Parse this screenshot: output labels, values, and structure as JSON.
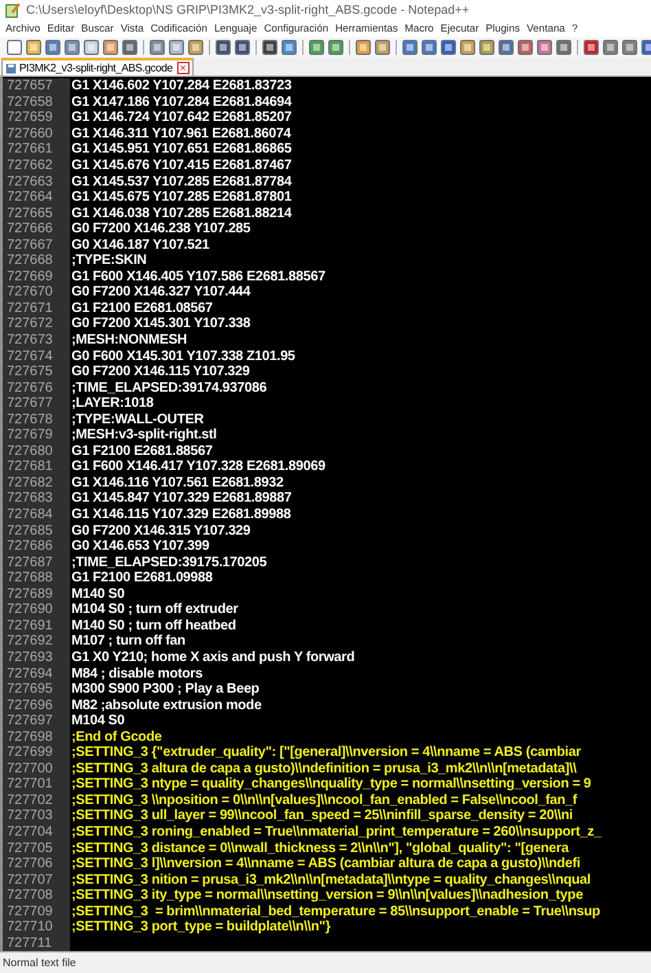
{
  "window": {
    "title": "C:\\Users\\eloyf\\Desktop\\NS GRIP\\PI3MK2_v3-split-right_ABS.gcode - Notepad++"
  },
  "menu": [
    "Archivo",
    "Editar",
    "Buscar",
    "Vista",
    "Codificación",
    "Lenguaje",
    "Configuración",
    "Herramientas",
    "Macro",
    "Ejecutar",
    "Plugins",
    "Ventana",
    "?"
  ],
  "tabs": [
    {
      "label": "PI3MK2_v3-split-right_ABS.gcode",
      "selected": true,
      "close": "×"
    }
  ],
  "editor": {
    "lines": [
      {
        "number": "727657",
        "text": "G1 X146.602 Y107.284 E2681.83723",
        "color": "#ffffff"
      },
      {
        "number": "727658",
        "text": "G1 X147.186 Y107.284 E2681.84694",
        "color": "#ffffff"
      },
      {
        "number": "727659",
        "text": "G1 X146.724 Y107.642 E2681.85207",
        "color": "#ffffff"
      },
      {
        "number": "727660",
        "text": "G1 X146.311 Y107.961 E2681.86074",
        "color": "#ffffff"
      },
      {
        "number": "727661",
        "text": "G1 X145.951 Y107.651 E2681.86865",
        "color": "#ffffff"
      },
      {
        "number": "727662",
        "text": "G1 X145.676 Y107.415 E2681.87467",
        "color": "#ffffff"
      },
      {
        "number": "727663",
        "text": "G1 X145.537 Y107.285 E2681.87784",
        "color": "#ffffff"
      },
      {
        "number": "727664",
        "text": "G1 X145.675 Y107.285 E2681.87801",
        "color": "#ffffff"
      },
      {
        "number": "727665",
        "text": "G1 X146.038 Y107.285 E2681.88214",
        "color": "#ffffff"
      },
      {
        "number": "727666",
        "text": "G0 F7200 X146.238 Y107.285",
        "color": "#ffffff"
      },
      {
        "number": "727667",
        "text": "G0 X146.187 Y107.521",
        "color": "#ffffff"
      },
      {
        "number": "727668",
        "text": ";TYPE:SKIN",
        "color": "#ffffff"
      },
      {
        "number": "727669",
        "text": "G1 F600 X146.405 Y107.586 E2681.88567",
        "color": "#ffffff"
      },
      {
        "number": "727670",
        "text": "G0 F7200 X146.327 Y107.444",
        "color": "#ffffff"
      },
      {
        "number": "727671",
        "text": "G1 F2100 E2681.08567",
        "color": "#ffffff"
      },
      {
        "number": "727672",
        "text": "G0 F7200 X145.301 Y107.338",
        "color": "#ffffff"
      },
      {
        "number": "727673",
        "text": ";MESH:NONMESH",
        "color": "#ffffff"
      },
      {
        "number": "727674",
        "text": "G0 F600 X145.301 Y107.338 Z101.95",
        "color": "#ffffff"
      },
      {
        "number": "727675",
        "text": "G0 F7200 X146.115 Y107.329",
        "color": "#ffffff"
      },
      {
        "number": "727676",
        "text": ";TIME_ELAPSED:39174.937086",
        "color": "#ffffff"
      },
      {
        "number": "727677",
        "text": ";LAYER:1018",
        "color": "#ffffff"
      },
      {
        "number": "727678",
        "text": ";TYPE:WALL-OUTER",
        "color": "#ffffff"
      },
      {
        "number": "727679",
        "text": ";MESH:v3-split-right.stl",
        "color": "#ffffff"
      },
      {
        "number": "727680",
        "text": "G1 F2100 E2681.88567",
        "color": "#ffffff"
      },
      {
        "number": "727681",
        "text": "G1 F600 X146.417 Y107.328 E2681.89069",
        "color": "#ffffff"
      },
      {
        "number": "727682",
        "text": "G1 X146.116 Y107.561 E2681.8932",
        "color": "#ffffff"
      },
      {
        "number": "727683",
        "text": "G1 X145.847 Y107.329 E2681.89887",
        "color": "#ffffff"
      },
      {
        "number": "727684",
        "text": "G1 X146.115 Y107.329 E2681.89988",
        "color": "#ffffff"
      },
      {
        "number": "727685",
        "text": "G0 F7200 X146.315 Y107.329",
        "color": "#ffffff"
      },
      {
        "number": "727686",
        "text": "G0 X146.653 Y107.399",
        "color": "#ffffff"
      },
      {
        "number": "727687",
        "text": ";TIME_ELAPSED:39175.170205",
        "color": "#ffffff"
      },
      {
        "number": "727688",
        "text": "G1 F2100 E2681.09988",
        "color": "#ffffff"
      },
      {
        "number": "727689",
        "text": "M140 S0",
        "color": "#ffffff"
      },
      {
        "number": "727690",
        "text": "M104 S0 ; turn off extruder",
        "color": "#ffffff"
      },
      {
        "number": "727691",
        "text": "M140 S0 ; turn off heatbed",
        "color": "#ffffff"
      },
      {
        "number": "727692",
        "text": "M107 ; turn off fan",
        "color": "#ffffff"
      },
      {
        "number": "727693",
        "text": "G1 X0 Y210; home X axis and push Y forward",
        "color": "#ffffff"
      },
      {
        "number": "727694",
        "text": "M84 ; disable motors",
        "color": "#ffffff"
      },
      {
        "number": "727695",
        "text": "M300 S900 P300 ; Play a Beep",
        "color": "#ffffff"
      },
      {
        "number": "727696",
        "text": "M82 ;absolute extrusion mode",
        "color": "#ffffff"
      },
      {
        "number": "727697",
        "text": "M104 S0",
        "color": "#ffffff"
      },
      {
        "number": "727698",
        "text": ";End of Gcode",
        "color": "#f0f020"
      },
      {
        "number": "727699",
        "text": ";SETTING_3 {\"extruder_quality\": [\"[general]\\\\nversion = 4\\\\nname = ABS (cambiar",
        "color": "#f0f020"
      },
      {
        "number": "727700",
        "text": ";SETTING_3 altura de capa a gusto)\\\\ndefinition = prusa_i3_mk2\\\\n\\\\n[metadata]\\\\",
        "color": "#f0f020"
      },
      {
        "number": "727701",
        "text": ";SETTING_3 ntype = quality_changes\\\\nquality_type = normal\\\\nsetting_version = 9",
        "color": "#f0f020"
      },
      {
        "number": "727702",
        "text": ";SETTING_3 \\\\nposition = 0\\\\n\\\\n[values]\\\\ncool_fan_enabled = False\\\\ncool_fan_f",
        "color": "#f0f020"
      },
      {
        "number": "727703",
        "text": ";SETTING_3 ull_layer = 99\\\\ncool_fan_speed = 25\\\\ninfill_sparse_density = 20\\\\ni",
        "color": "#f0f020"
      },
      {
        "number": "727704",
        "text": ";SETTING_3 roning_enabled = True\\\\nmaterial_print_temperature = 260\\\\nsupport_z_",
        "color": "#f0f020"
      },
      {
        "number": "727705",
        "text": ";SETTING_3 distance = 0\\\\nwall_thickness = 2\\\\n\\\\n\"], \"global_quality\": \"[genera",
        "color": "#f0f020"
      },
      {
        "number": "727706",
        "text": ";SETTING_3 l]\\\\nversion = 4\\\\nname = ABS (cambiar altura de capa a gusto)\\\\ndefi",
        "color": "#f0f020"
      },
      {
        "number": "727707",
        "text": ";SETTING_3 nition = prusa_i3_mk2\\\\n\\\\n[metadata]\\\\ntype = quality_changes\\\\nqual",
        "color": "#f0f020"
      },
      {
        "number": "727708",
        "text": ";SETTING_3 ity_type = normal\\\\nsetting_version = 9\\\\n\\\\n[values]\\\\nadhesion_type",
        "color": "#f0f020"
      },
      {
        "number": "727709",
        "text": ";SETTING_3  = brim\\\\nmaterial_bed_temperature = 85\\\\nsupport_enable = True\\\\nsup",
        "color": "#f0f020"
      },
      {
        "number": "727710",
        "text": ";SETTING_3 port_type = buildplate\\\\n\\\\n\"}",
        "color": "#f0f020"
      },
      {
        "number": "727711"
      }
    ]
  },
  "status_bar": {
    "text": "Normal text file"
  }
}
